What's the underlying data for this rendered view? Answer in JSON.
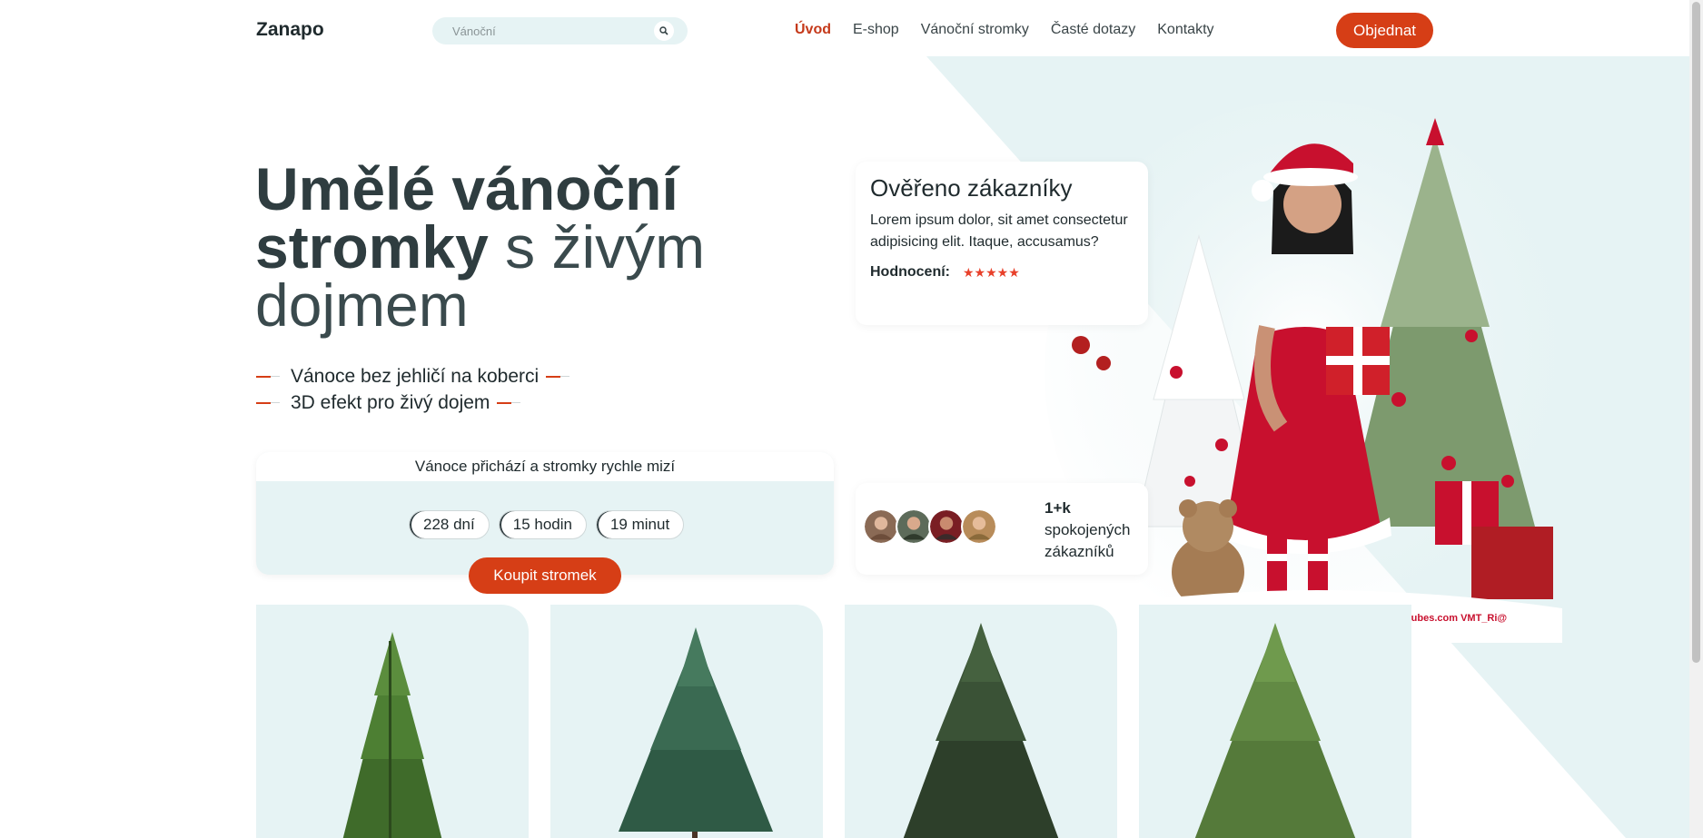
{
  "header": {
    "logo": "Zanapo",
    "search_placeholder": "Vánoční",
    "nav": [
      {
        "label": "Úvod",
        "active": true
      },
      {
        "label": "E-shop",
        "active": false
      },
      {
        "label": "Vánoční stromky",
        "active": false
      },
      {
        "label": "Časté dotazy",
        "active": false
      },
      {
        "label": "Kontakty",
        "active": false
      }
    ],
    "order_label": "Objednat"
  },
  "hero": {
    "title_bold_1": "Umělé vánoční",
    "title_bold_2": "stromky",
    "title_light_1": "s živým",
    "title_light_2": "dojmem",
    "bullets": [
      "Vánoce bez jehličí na koberci",
      "3D efekt pro živý dojem"
    ]
  },
  "countdown": {
    "heading": "Vánoce přichází a stromky rychle mizí",
    "days": "228 dní",
    "hours": "15 hodin",
    "minutes": "19 minut",
    "buy_label": "Koupit stromek"
  },
  "review": {
    "title": "Ověřeno zákazníky",
    "text": "Lorem ipsum dolor, sit amet consectetur adipisicing elit. Itaque, accusamus?",
    "rating_label": "Hodnocení:",
    "stars": "★★★★★"
  },
  "customers": {
    "count": "1+k",
    "label_1": "spokojených",
    "label_2": "zákazníků"
  },
  "hero_image_caption": "tubes.com VMT_Ri@",
  "colors": {
    "accent": "#d63e16",
    "mint": "#e6f3f4",
    "text": "#2f3d40"
  },
  "icons": {
    "search": "search-icon",
    "star": "star-icon"
  }
}
